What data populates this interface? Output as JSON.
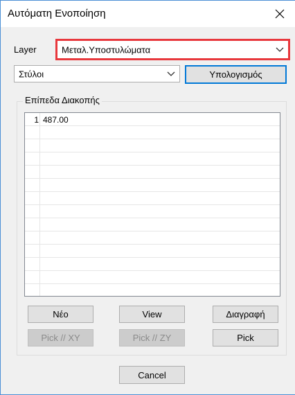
{
  "window": {
    "title": "Αυτόματη Ενοποίηση"
  },
  "layer": {
    "label": "Layer",
    "selected": "Μεταλ.Υποστυλώματα"
  },
  "type_select": {
    "selected": "Στύλοι"
  },
  "buttons": {
    "calculate": "Υπολογισμός",
    "new": "Νέο",
    "view": "View",
    "delete": "Διαγραφή",
    "pick_xy": "Pick // XY",
    "pick_zy": "Pick // ZY",
    "pick": "Pick",
    "cancel": "Cancel"
  },
  "group": {
    "title": "Επίπεδα Διακοπής",
    "rows": [
      {
        "num": "1",
        "value": "487.00"
      },
      {
        "num": "",
        "value": ""
      },
      {
        "num": "",
        "value": ""
      },
      {
        "num": "",
        "value": ""
      },
      {
        "num": "",
        "value": ""
      },
      {
        "num": "",
        "value": ""
      },
      {
        "num": "",
        "value": ""
      },
      {
        "num": "",
        "value": ""
      },
      {
        "num": "",
        "value": ""
      },
      {
        "num": "",
        "value": ""
      },
      {
        "num": "",
        "value": ""
      },
      {
        "num": "",
        "value": ""
      },
      {
        "num": "",
        "value": ""
      },
      {
        "num": "",
        "value": ""
      }
    ]
  },
  "colors": {
    "highlight": "#e8383d",
    "default_button": "#0078d7",
    "window_border": "#4a8fd6"
  }
}
